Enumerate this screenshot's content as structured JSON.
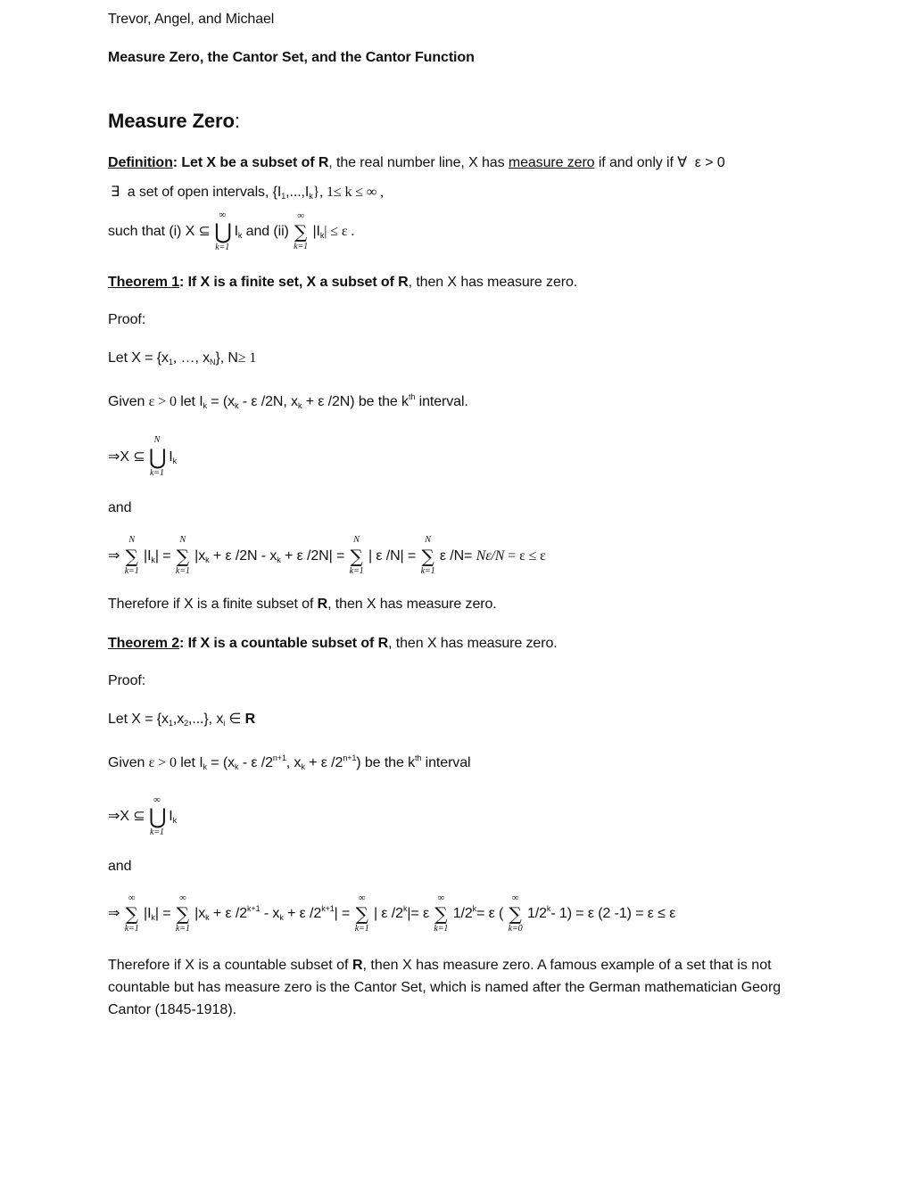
{
  "header": {
    "authors": "Trevor, Angel, and Michael",
    "title": "Measure Zero, the Cantor Set, and the Cantor Function"
  },
  "section": {
    "heading": "Measure Zero",
    "heading_colon": ":"
  },
  "definition": {
    "label": "Definition",
    "bold_statement": ": Let X be a subset of R",
    "line1_rest_a": ", the real number line, X has ",
    "measure_zero_link": "measure zero",
    "line1_rest_b": " if and only if ",
    "forall": "∀",
    "eps_gt_zero": "ε > 0",
    "exists": "∃",
    "line2_text": "a set of open intervals, {I",
    "line2_sub1": "1",
    "line2_mid": ",...,I",
    "line2_subk": "k",
    "line2_end": "}, 1≤ k ≤ ∞ ,",
    "line3_prefix": "such that (i) X ⊆ ",
    "line3_union_top": "∞",
    "line3_union_bottom": "k=1",
    "line3_ik": "I",
    "line3_ik_sub": "k",
    "line3_and": " and (ii) ",
    "line3_sum_top": "∞",
    "line3_sum_bottom": "k=1",
    "line3_abs": " |I",
    "line3_abs_sub": "k",
    "line3_end": "| ≤ ε ."
  },
  "theorem1": {
    "label": "Theorem 1",
    "bold_statement": ": If X is a finite set, X a subset of R",
    "rest": ", then X has measure zero.",
    "proof_label": "Proof:",
    "let_line": {
      "a": "Let X = {x",
      "sub1": "1",
      "b": ", …, x",
      "subN": "N",
      "c": "}, N",
      "d": "≥ 1"
    },
    "given_line": {
      "a": "Given ",
      "b": "ε > 0",
      "c": "  let I",
      "d": " = (x",
      "e": " - ε /2N, x",
      "f": " + ε /2N) be the k",
      "sup": "th",
      "g": " interval.",
      "sub_k": "k"
    },
    "implies_line": {
      "arrow": "⇒",
      "a": "X ⊆ ",
      "union_top": "N",
      "union_bottom": "k=1",
      "ik": "I",
      "ik_sub": "k"
    },
    "and_label": "and",
    "sum_line": {
      "arrow": "⇒",
      "top": "N",
      "bottom": "k=1",
      "t1": " |I",
      "t1_sub": "k",
      "t1_end": "| = ",
      "t2": " |x",
      "t2_sub": "k",
      "t2_mid": " + ε /2N - x",
      "t2_sub2": "k",
      "t2_end": " + ε /2N| = ",
      "t3": " | ε /N| =",
      "t4": "  ε /N= ",
      "t4_serif": "Nε/N",
      "t5": "  =  ε ≤  ε"
    },
    "conclusion": "Therefore if X is a finite subset of R, then X has measure zero."
  },
  "theorem2": {
    "label": "Theorem 2",
    "bold_statement": ": If X is a countable subset of R",
    "rest": ", then X has measure zero.",
    "proof_label": "Proof:",
    "let_line": {
      "a": "Let X = {x",
      "sub1": "1",
      "b": ",x",
      "sub2": "2",
      "c": ",...},  x",
      "subi": "i",
      "d": "  ∈  ",
      "e": "R"
    },
    "given_line": {
      "a": "Given ",
      "b": "ε > 0",
      "c": "  let I",
      "sub_k": "k",
      "d": " = (x",
      "e": " -  ε /2",
      "sup1": "n+1",
      "f": ", x",
      "g": " +  ε /2",
      "sup2": "n+1",
      "h": ") be the k",
      "sup3": "th",
      "i": " interval"
    },
    "implies_line": {
      "arrow": "⇒",
      "a": "X  ⊆  ",
      "union_top": "∞",
      "union_bottom": "k=1",
      "ik": "I",
      "ik_sub": "k"
    },
    "and_label": "and",
    "sum_line": {
      "arrow": "⇒",
      "top": "∞",
      "bottom1": "k=1",
      "bottom0": "k=0",
      "t1": " |I",
      "t1_sub": "k",
      "t1_end": "| = ",
      "t2": " |x",
      "t2_sub": "k",
      "t2_mid": " + ε /2",
      "t2_sup": "k+1",
      "t2_mid2": " - x",
      "t2_sub2": "k",
      "t2_mid3": " + ε /2",
      "t2_sup2": "k+1",
      "t2_end": "| = ",
      "t3": " | ε /2",
      "t3_sup": "k",
      "t3_end": "|= ε ",
      "t4": " 1/2",
      "t4_sup": "k",
      "t4_end": "= ε ( ",
      "t5": " 1/2",
      "t5_sup": "k",
      "t5_end": "- 1) = ε (2 -1) = ε  ≤  ε"
    },
    "conclusion_a": "Therefore if X is a countable subset of ",
    "conclusion_R": "R",
    "conclusion_b": ", then X has measure zero.  A famous example of a set that is not countable but has measure zero is the Cantor Set, which is named after the German mathematician Georg Cantor (1845-1918)."
  },
  "symbols": {
    "union": "⋃",
    "sum": "∑"
  }
}
